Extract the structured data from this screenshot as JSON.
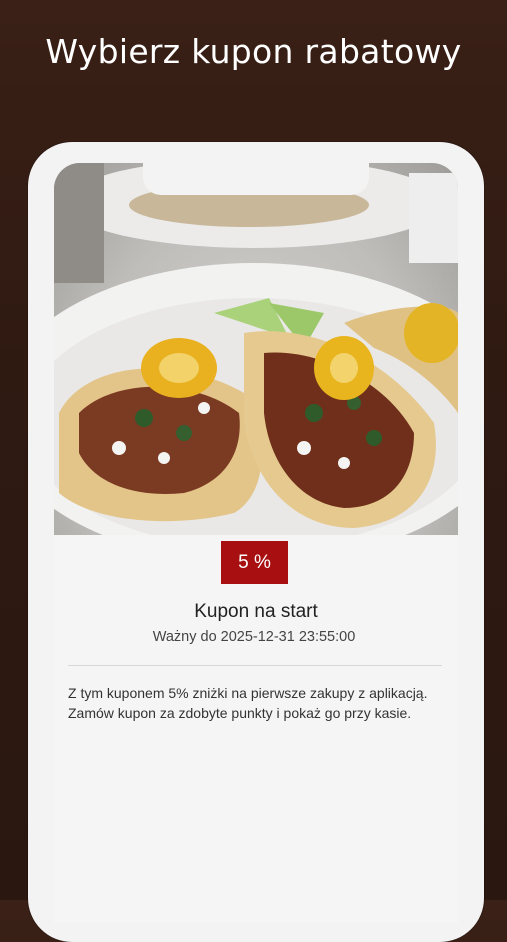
{
  "headline": "Wybierz kupon rabatowy",
  "coupon": {
    "image_alt": "tacos-photo",
    "discount_badge": "5 %",
    "title": "Kupon na start",
    "valid_label": "Ważny do",
    "valid_until": "2025-12-31 23:55:00",
    "description": "Z tym kuponem 5% zniżki na pierwsze zakupy z aplikacją. Zamów kupon za zdobyte punkty i pokaż go przy kasie."
  },
  "colors": {
    "background": "#2f1a12",
    "badge": "#a70f10",
    "phone_frame": "#f3f3f3"
  }
}
